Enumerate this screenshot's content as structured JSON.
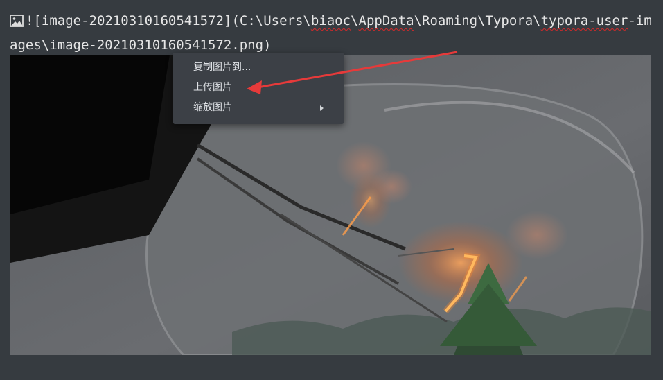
{
  "editor": {
    "markdown_source": {
      "prefix": "![",
      "alt": "image-20210310160541572",
      "middle": "](C:\\Users\\",
      "user": "biaoc",
      "sep1": "\\",
      "appdata": "AppData",
      "rest1": "\\Roaming\\Typora\\",
      "typora_user": "typora-user",
      "rest2": "-images\\image-20210310160541572.png)"
    },
    "icon": "image-icon"
  },
  "context_menu": {
    "items": [
      {
        "label": "复制图片到...",
        "has_submenu": false
      },
      {
        "label": "上传图片",
        "has_submenu": false
      },
      {
        "label": "缩放图片",
        "has_submenu": true
      }
    ]
  },
  "annotation": {
    "arrow_color": "#e63a3a",
    "points_to": "上传图片"
  },
  "colors": {
    "background": "#363b40",
    "menu_background": "#3c4046",
    "text": "#e6e6e6"
  }
}
